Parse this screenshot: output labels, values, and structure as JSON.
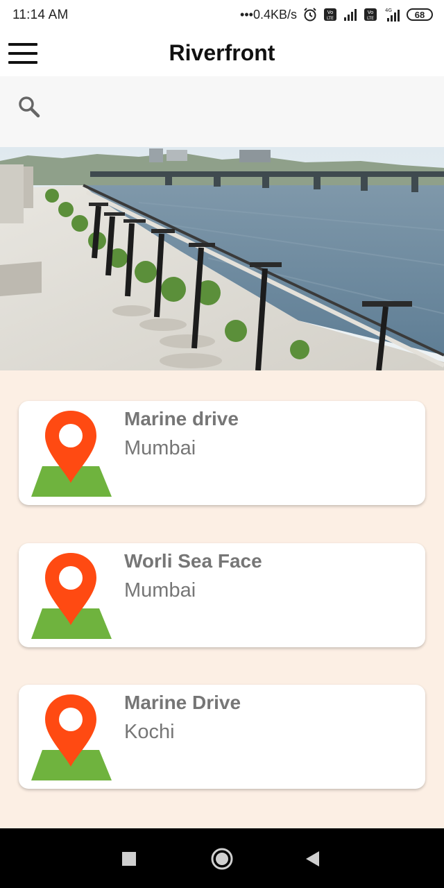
{
  "status_bar": {
    "time": "11:14 AM",
    "network_speed": "•••0.4KB/s",
    "battery": "68",
    "icons": [
      "alarm-icon",
      "volte-icon",
      "signal-icon",
      "volte-icon",
      "4g-signal-icon",
      "battery-icon"
    ]
  },
  "app_bar": {
    "title": "Riverfront",
    "menu_icon": "hamburger-menu-icon"
  },
  "search": {
    "icon": "search-icon"
  },
  "hero": {
    "image": "riverfront-promenade-photo"
  },
  "places": [
    {
      "name": "Marine drive",
      "city": "Mumbai",
      "icon": "map-pin-icon"
    },
    {
      "name": "Worli Sea Face",
      "city": "Mumbai",
      "icon": "map-pin-icon"
    },
    {
      "name": "Marine Drive",
      "city": "Kochi",
      "icon": "map-pin-icon"
    }
  ],
  "nav": {
    "buttons": [
      "recents-button",
      "home-button",
      "back-button"
    ]
  },
  "colors": {
    "pin_red": "#ff4a12",
    "ground_green": "#6fb33e",
    "list_background": "#fcefe4",
    "card_text": "#767676",
    "nav_bar": "#000000"
  }
}
